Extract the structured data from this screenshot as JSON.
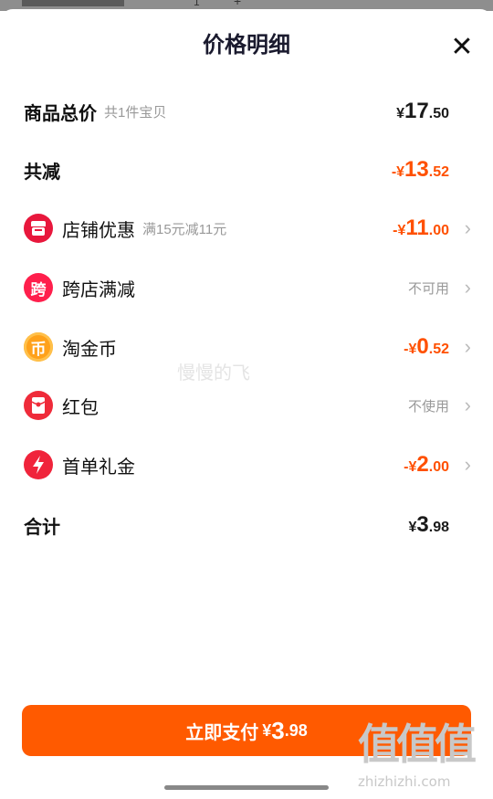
{
  "background_strip": {
    "quantity": "1",
    "plus": "+"
  },
  "header": {
    "title": "价格明细",
    "close": "✕"
  },
  "summary": {
    "total_label": "商品总价",
    "total_sub": "共1件宝贝",
    "total_sym": "¥",
    "total_int": "17",
    "total_dec": ".50",
    "reduce_label": "共减",
    "reduce_sym": "-¥",
    "reduce_int": "13",
    "reduce_dec": ".52"
  },
  "items": [
    {
      "label": "店铺优惠",
      "sub": "满15元减11元",
      "sym": "-¥",
      "int": "11",
      "dec": ".00",
      "icon": "shop-icon",
      "icon_color": "#e8173c"
    },
    {
      "label": "跨店满减",
      "status": "不可用",
      "icon": "cross-store-icon",
      "icon_char": "跨",
      "icon_color": "#ff1f4c"
    },
    {
      "label": "淘金币",
      "sym": "-¥",
      "int": "0",
      "dec": ".52",
      "icon": "coin-icon",
      "icon_char": "币",
      "icon_color": "#ffa11a"
    },
    {
      "label": "红包",
      "status": "不使用",
      "icon": "red-packet-icon",
      "icon_color": "#ef2b3a"
    },
    {
      "label": "首单礼金",
      "sym": "-¥",
      "int": "2",
      "dec": ".00",
      "icon": "lightning-icon",
      "icon_color": "#f0243b"
    }
  ],
  "total": {
    "label": "合计",
    "sym": "¥",
    "int": "3",
    "dec": ".98"
  },
  "watermark": "慢慢的飞",
  "pay_button": {
    "label": "立即支付",
    "sym": "¥",
    "int": "3",
    "dec": ".98"
  },
  "logo": {
    "text": "值值值",
    "domain": "zhizhizhi.com"
  },
  "colors": {
    "accent": "#ff5000",
    "button": "#ff5a00"
  }
}
